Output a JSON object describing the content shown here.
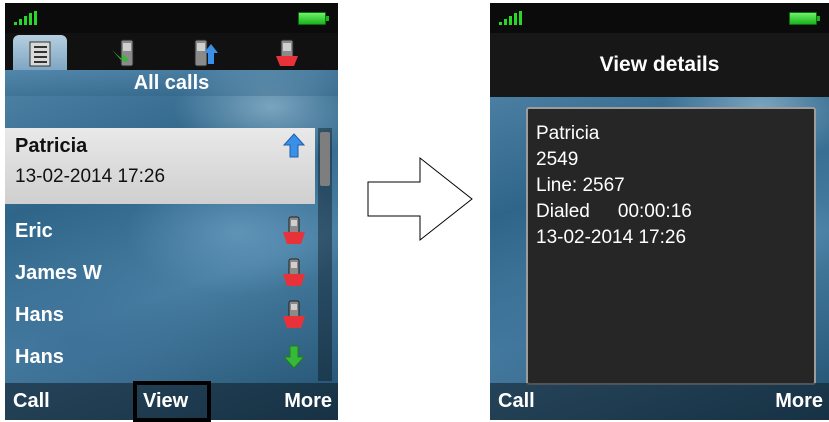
{
  "left_screen": {
    "tabs": [
      {
        "icon": "call-list-icon",
        "active": true
      },
      {
        "icon": "missed-call-icon",
        "active": false
      },
      {
        "icon": "dialed-call-icon",
        "active": false
      },
      {
        "icon": "rejected-call-icon",
        "active": false
      }
    ],
    "list_title": "All calls",
    "selected_call": {
      "name": "Patricia",
      "date": "13-02-2014 17:26",
      "icon": "dialed-arrow-icon"
    },
    "calls": [
      {
        "name": "Eric",
        "icon": "rejected-call-icon"
      },
      {
        "name": "James W",
        "icon": "rejected-call-icon"
      },
      {
        "name": "Hans",
        "icon": "rejected-call-icon"
      },
      {
        "name": "Hans",
        "icon": "received-arrow-icon"
      }
    ],
    "softkeys": {
      "left": "Call",
      "center": "View",
      "right": "More"
    }
  },
  "right_screen": {
    "title": "View details",
    "details": {
      "name": "Patricia",
      "number": "2549",
      "line": "Line: 2567",
      "call_type": "Dialed",
      "duration": "00:00:16",
      "datetime": "13-02-2014 17:26"
    },
    "softkeys": {
      "left": "Call",
      "right": "More"
    }
  },
  "colors": {
    "signal": "#27d827",
    "battery": "#19b419",
    "dialed_arrow": "#3a8fe8",
    "received_arrow": "#38b838",
    "rejected_red": "#e8323a"
  }
}
